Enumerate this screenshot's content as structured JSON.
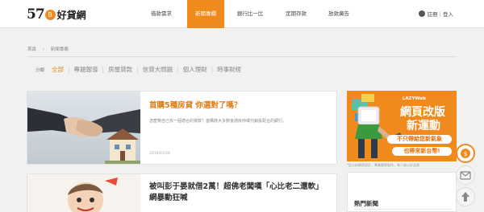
{
  "header": {
    "logo": {
      "number": "57",
      "coin": "B",
      "name": "好貸網"
    },
    "nav": [
      {
        "label": "借款需求",
        "active": false
      },
      {
        "label": "新聞專欄",
        "active": true
      },
      {
        "label": "銀行比一比",
        "active": false
      },
      {
        "label": "定期存款",
        "active": false
      },
      {
        "label": "放款廣告",
        "active": false
      }
    ],
    "login": {
      "label": "註冊｜登入",
      "icon": "user-icon"
    }
  },
  "breadcrumb": [
    "首頁",
    "新聞專欄"
  ],
  "categories": {
    "label": "分類",
    "items": [
      {
        "label": "全部",
        "active": true
      },
      {
        "label": "專題報導",
        "active": false
      },
      {
        "label": "房屋貸款",
        "active": false
      },
      {
        "label": "信貸大問題",
        "active": false
      },
      {
        "label": "個人理財",
        "active": false
      },
      {
        "label": "時事財經",
        "active": false
      }
    ]
  },
  "articles": [
    {
      "title": "首購5種房貸 你選對了嗎？",
      "desc": "怎麼幫自己找一個適合的貸款？首購族大多數會請房仲或代銷投配合的銀行。",
      "date": "2019/01/26",
      "image": "handshake-house-image"
    },
    {
      "title": "被叫彭于晏就借2萬！超佛老闆嘆「心比老二還軟」　網暴動狂喊",
      "image": "cartoon-image"
    }
  ],
  "sidebar": {
    "ad": {
      "logo": "LAZYWeb",
      "line1": "網頁改版",
      "line2": "新運動",
      "pill1": "不只帶給您新氣象",
      "pill2": "也帶來新台幣!",
      "caption": "*此分析網頁設計，專業團隊製作，有人放心好品質"
    },
    "hot_title": "熱門新聞"
  },
  "floating": [
    "coin-icon",
    "mail-icon",
    "arrow-up-icon"
  ],
  "colors": {
    "accent": "#f08a1c",
    "background": "#f1f1f1"
  }
}
